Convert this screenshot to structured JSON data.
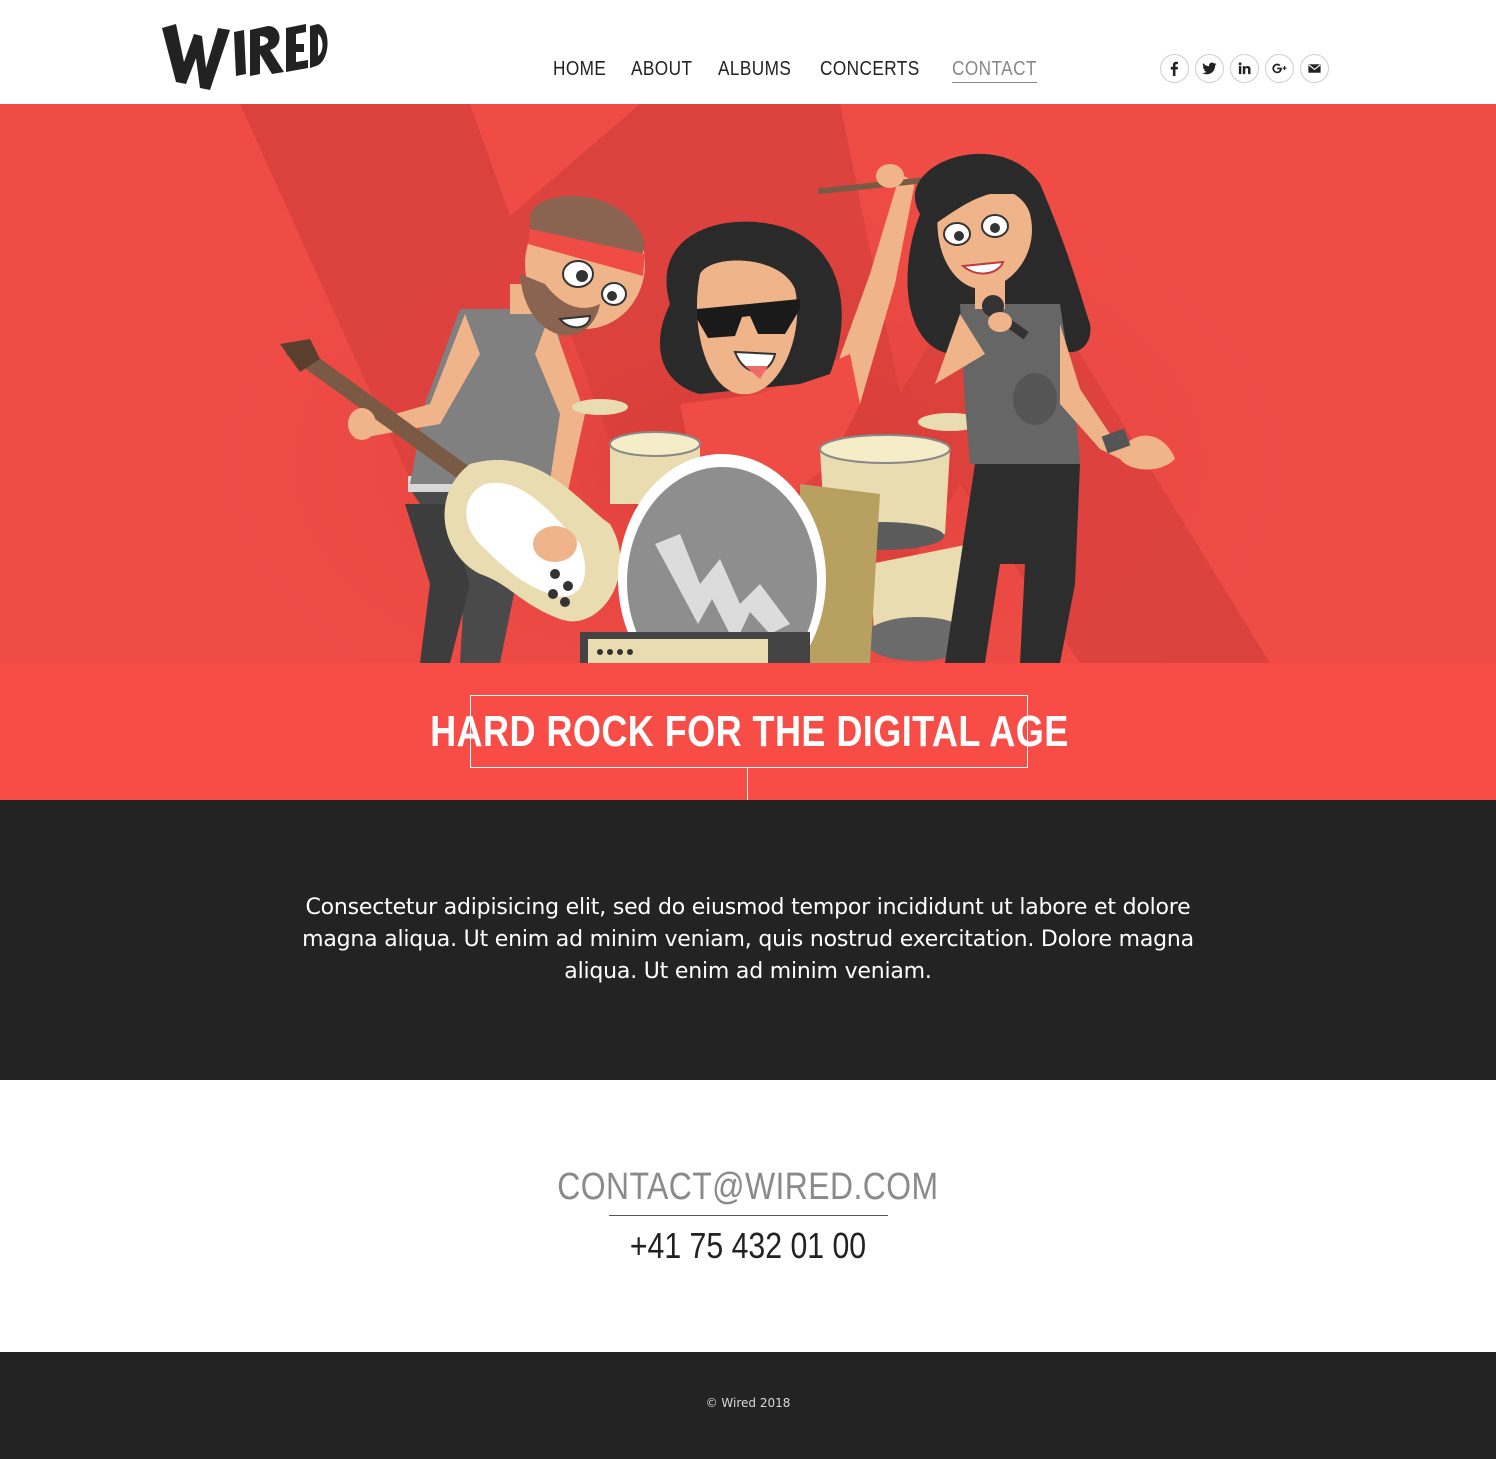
{
  "brand": {
    "logo_text": "WIRED"
  },
  "nav": {
    "items": [
      {
        "label": "HOME"
      },
      {
        "label": "ABOUT"
      },
      {
        "label": "ALBUMS"
      },
      {
        "label": "CONCERTS"
      },
      {
        "label": "CONTACT",
        "active": true
      }
    ]
  },
  "social": [
    {
      "icon": "facebook-icon"
    },
    {
      "icon": "twitter-icon"
    },
    {
      "icon": "linkedin-icon"
    },
    {
      "icon": "google-plus-icon"
    },
    {
      "icon": "email-icon"
    }
  ],
  "hero": {
    "image": "cartoon rock band illustration"
  },
  "tagline": {
    "text": "HARD ROCK FOR THE DIGITAL AGE"
  },
  "about": {
    "text": "Consectetur adipisicing elit, sed do eiusmod tempor incididunt ut labore et dolore magna aliqua. Ut enim ad minim veniam, quis nostrud exercitation. Dolore magna aliqua. Ut enim ad minim veniam."
  },
  "contact": {
    "email": "CONTACT@WIRED.COM",
    "phone": "+41 75 432 01 00"
  },
  "footer": {
    "copyright": "© Wired 2018"
  },
  "colors": {
    "accent": "#f84c46",
    "hero_bg": "#e94a45",
    "dark": "#232323",
    "nav_active": "#888888"
  }
}
